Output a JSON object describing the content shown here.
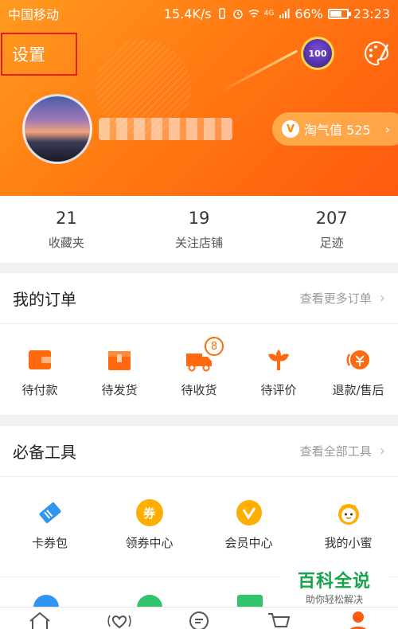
{
  "status_bar": {
    "carrier": "中国移动",
    "speed": "15.4K/s",
    "network": "4G",
    "battery": "66%",
    "time": "23:23"
  },
  "header": {
    "settings_label": "设置",
    "badge_label": "100",
    "taoqi_label": "淘气值 525",
    "taoqi_icon": "v-icon"
  },
  "stats": [
    {
      "count": "21",
      "label": "收藏夹"
    },
    {
      "count": "19",
      "label": "关注店铺"
    },
    {
      "count": "207",
      "label": "足迹"
    }
  ],
  "orders": {
    "title": "我的订单",
    "more": "查看更多订单",
    "items": [
      {
        "label": "待付款",
        "icon": "wallet-icon"
      },
      {
        "label": "待发货",
        "icon": "package-icon"
      },
      {
        "label": "待收货",
        "icon": "truck-icon",
        "badge": "8"
      },
      {
        "label": "待评价",
        "icon": "flower-icon"
      },
      {
        "label": "退款/售后",
        "icon": "refund-icon"
      }
    ]
  },
  "tools": {
    "title": "必备工具",
    "more": "查看全部工具",
    "items": [
      {
        "label": "卡券包",
        "icon": "ticket-icon"
      },
      {
        "label": "领券中心",
        "icon_text": "券",
        "icon": "coupon-icon"
      },
      {
        "label": "会员中心",
        "icon": "member-icon"
      },
      {
        "label": "我的小蜜",
        "icon": "assistant-icon"
      }
    ]
  },
  "watermark": {
    "title": "百科全说",
    "subtitle": "助你轻松解决"
  },
  "colors": {
    "brand": "#ff7a12",
    "highlight": "#e0201a"
  }
}
